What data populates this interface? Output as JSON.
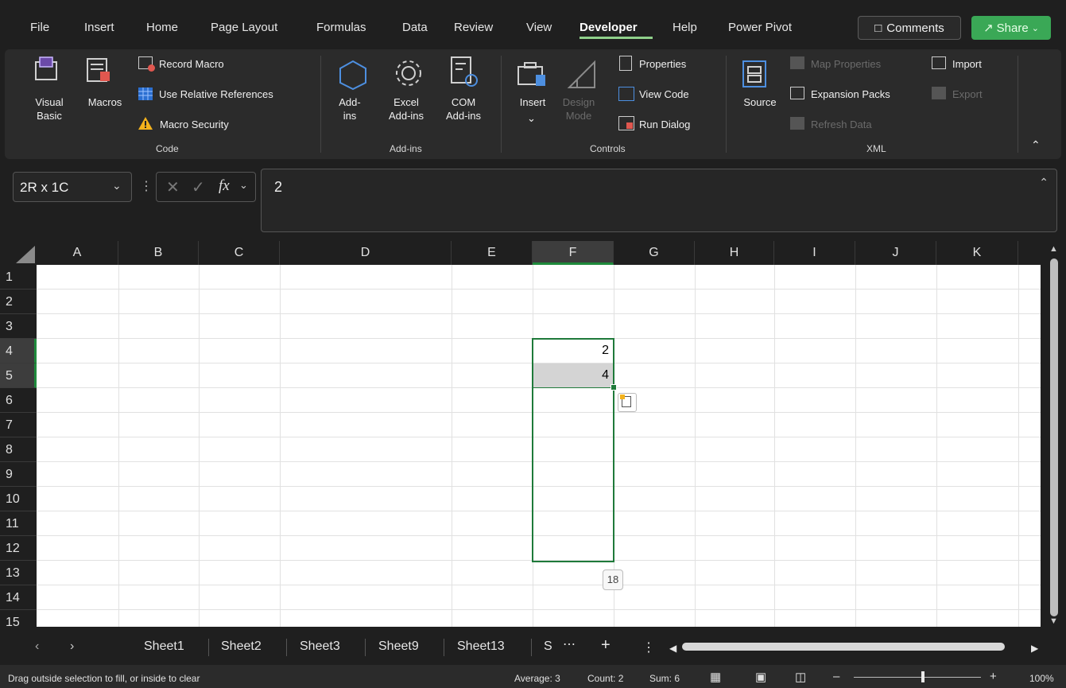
{
  "menu": {
    "items": [
      "File",
      "Insert",
      "Home",
      "Page Layout",
      "Formulas",
      "Data",
      "Review",
      "View",
      "Developer",
      "Help",
      "Power Pivot"
    ],
    "active": "Developer",
    "comments_label": "Comments",
    "share_label": "Share"
  },
  "ribbon": {
    "code": {
      "visual_basic": "Visual\nBasic",
      "macros": "Macros",
      "record_macro": "Record Macro",
      "use_relative": "Use Relative References",
      "macro_security": "Macro Security",
      "group": "Code"
    },
    "addins": {
      "addins": "Add-\nins",
      "excel_addins": "Excel\nAdd-ins",
      "com_addins": "COM\nAdd-ins",
      "group": "Add-ins"
    },
    "controls": {
      "insert": "Insert",
      "design_mode": "Design\nMode",
      "properties": "Properties",
      "view_code": "View Code",
      "run_dialog": "Run Dialog",
      "group": "Controls"
    },
    "xml": {
      "source": "Source",
      "map_properties": "Map Properties",
      "expansion_packs": "Expansion Packs",
      "refresh_data": "Refresh Data",
      "import": "Import",
      "export": "Export",
      "group": "XML"
    }
  },
  "formula_bar": {
    "name_box": "2R x 1C",
    "fx": "fx",
    "value": "2"
  },
  "grid": {
    "columns": [
      "A",
      "B",
      "C",
      "D",
      "E",
      "F",
      "G",
      "H",
      "I",
      "J",
      "K"
    ],
    "selected_column": "F",
    "rows": [
      "1",
      "2",
      "3",
      "4",
      "5",
      "6",
      "7",
      "8",
      "9",
      "10",
      "11",
      "12",
      "13",
      "14",
      "15"
    ],
    "selected_rows": [
      "4",
      "5"
    ],
    "cells": {
      "F4": "2",
      "F5": "4"
    },
    "fill_tooltip": "18"
  },
  "sheet_tabs": [
    "Sheet1",
    "Sheet2",
    "Sheet3",
    "Sheet9",
    "Sheet13",
    "S"
  ],
  "status": {
    "message": "Drag outside selection to fill, or inside to clear",
    "average": "Average: 3",
    "count": "Count: 2",
    "sum": "Sum: 6",
    "zoom": "100%"
  },
  "colors": {
    "accent_green": "#1f8a3c",
    "share_green": "#3aa856"
  }
}
